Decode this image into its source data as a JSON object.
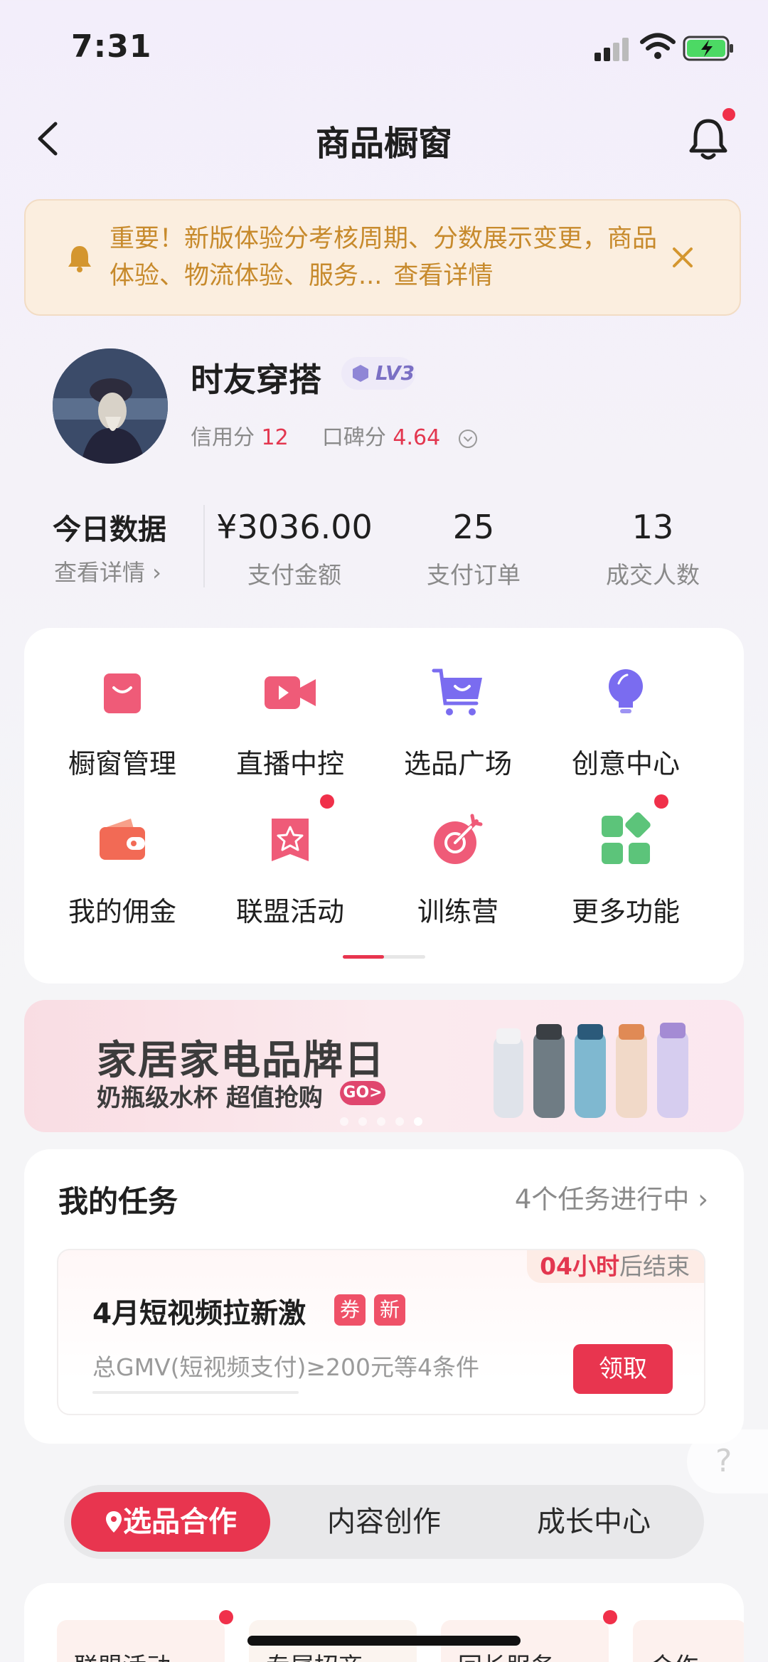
{
  "status_bar": {
    "time": "7:31"
  },
  "nav": {
    "title": "商品橱窗"
  },
  "notice": {
    "text": "重要！新版体验分考核周期、分数展示变更，商品体验、物流体验、服务...",
    "link": "查看详情"
  },
  "profile": {
    "name": "时友穿搭",
    "level": "LV3",
    "credit_label": "信用分",
    "credit_value": "12",
    "reputation_label": "口碑分",
    "reputation_value": "4.64"
  },
  "today": {
    "title": "今日数据",
    "link": "查看详情 ›",
    "metrics": [
      {
        "value": "¥3036.00",
        "label": "支付金额"
      },
      {
        "value": "25",
        "label": "支付订单"
      },
      {
        "value": "13",
        "label": "成交人数"
      }
    ]
  },
  "tools": [
    {
      "label": "橱窗管理",
      "icon": "shopping-bag-icon"
    },
    {
      "label": "直播中控",
      "icon": "video-camera-icon"
    },
    {
      "label": "选品广场",
      "icon": "shopping-cart-icon"
    },
    {
      "label": "创意中心",
      "icon": "lightbulb-icon"
    },
    {
      "label": "我的佣金",
      "icon": "wallet-icon"
    },
    {
      "label": "联盟活动",
      "icon": "star-badge-icon"
    },
    {
      "label": "训练营",
      "icon": "target-icon"
    },
    {
      "label": "更多功能",
      "icon": "grid-icon"
    }
  ],
  "banner": {
    "title": "家居家电品牌日",
    "subtitle": "奶瓶级水杯 超值抢购",
    "go": "GO>"
  },
  "tasks": {
    "title": "我的任务",
    "link": "4个任务进行中 ›",
    "card": {
      "timer_value": "04小时",
      "timer_suffix": "后结束",
      "name": "4月短视频拉新激",
      "tag_coupon": "券",
      "tag_new": "新",
      "desc": "总GMV(短视频支付)≥200元等4条件",
      "button": "领取"
    }
  },
  "help": {
    "label": "?"
  },
  "segment_tabs": [
    "选品合作",
    "内容创作",
    "成长中心"
  ],
  "bottom_items": [
    "联盟活动 ›",
    "专属招商 ›",
    "回长服务 ›",
    "合作"
  ],
  "colors": {
    "accent": "#e8354f",
    "notice_text": "#c78a2c",
    "badge_dot": "#f0304a"
  }
}
